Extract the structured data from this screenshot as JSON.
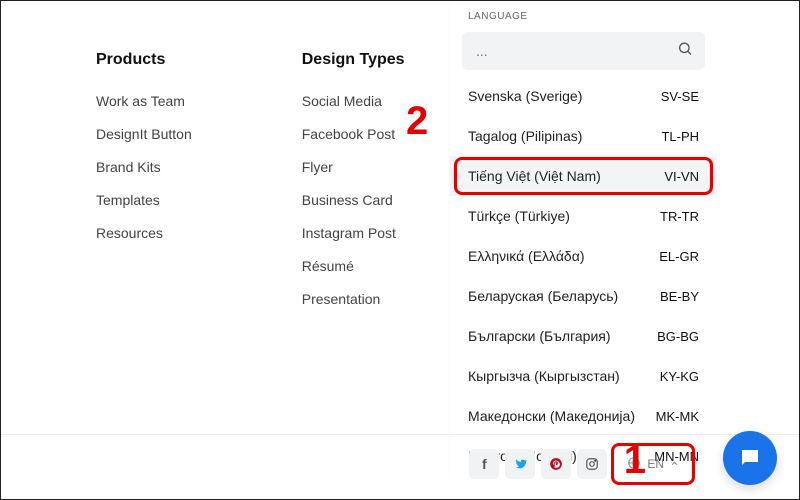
{
  "columns": {
    "products": {
      "title": "Products",
      "items": [
        "Work as Team",
        "DesignIt Button",
        "Brand Kits",
        "Templates",
        "Resources"
      ]
    },
    "design_types": {
      "title": "Design Types",
      "items": [
        "Social Media",
        "Facebook Post",
        "Flyer",
        "Business Card",
        "Instagram Post",
        "Résumé",
        "Presentation"
      ]
    }
  },
  "language_panel": {
    "title": "LANGUAGE",
    "search_placeholder": "...",
    "options": [
      {
        "name": "Svenska (Sverige)",
        "code": "SV-SE",
        "highlight": false
      },
      {
        "name": "Tagalog (Pilipinas)",
        "code": "TL-PH",
        "highlight": false
      },
      {
        "name": "Tiếng Việt (Việt Nam)",
        "code": "VI-VN",
        "highlight": true
      },
      {
        "name": "Türkçe (Türkiye)",
        "code": "TR-TR",
        "highlight": false
      },
      {
        "name": "Ελληνικά (Ελλάδα)",
        "code": "EL-GR",
        "highlight": false
      },
      {
        "name": "Беларуская (Беларусь)",
        "code": "BE-BY",
        "highlight": false
      },
      {
        "name": "Български (България)",
        "code": "BG-BG",
        "highlight": false
      },
      {
        "name": "Кыргызча (Кыргызстан)",
        "code": "KY-KG",
        "highlight": false
      },
      {
        "name": "Македонски (Македонија)",
        "code": "MK-MK",
        "highlight": false
      },
      {
        "name": "Монгол (Монгол)",
        "code": "MN-MN",
        "highlight": false
      }
    ]
  },
  "bottom": {
    "social": [
      "facebook",
      "twitter",
      "pinterest",
      "instagram"
    ],
    "lang_button_label": "EN"
  },
  "callouts": {
    "one": "1",
    "two": "2"
  }
}
